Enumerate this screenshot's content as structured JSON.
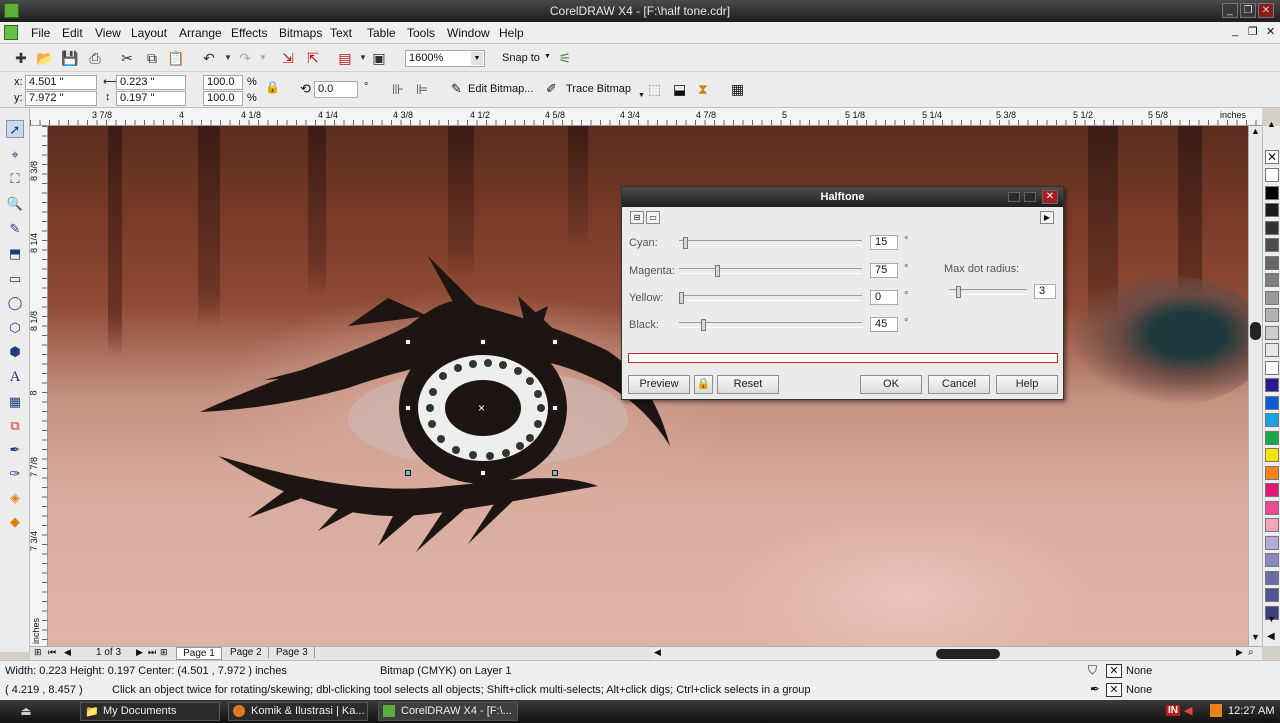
{
  "window": {
    "title": "CorelDRAW X4 - [F:\\half tone.cdr]"
  },
  "menu": [
    "File",
    "Edit",
    "View",
    "Layout",
    "Arrange",
    "Effects",
    "Bitmaps",
    "Text",
    "Table",
    "Tools",
    "Window",
    "Help"
  ],
  "standard_toolbar": {
    "zoom": "1600%",
    "snap_to": "Snap to"
  },
  "property_bar": {
    "x_label": "x:",
    "x": "4.501 \"",
    "y_label": "y:",
    "y": "7.972 \"",
    "width": "0.223 \"",
    "height": "0.197 \"",
    "scale_x": "100.0",
    "scale_y": "100.0",
    "percent": "%",
    "rotation": "0.0",
    "degree": "°",
    "edit_bitmap": "Edit Bitmap...",
    "trace_bitmap": "Trace Bitmap"
  },
  "ruler": {
    "h_labels": [
      "3 7/8",
      "4",
      "4 1/8",
      "4 1/4",
      "4 3/8",
      "4 1/2",
      "4 5/8",
      "4 3/4",
      "4 7/8",
      "5",
      "5 1/8",
      "5 1/4",
      "5 3/8",
      "5 1/2",
      "5 5/8"
    ],
    "h_unit": "inches",
    "v_labels": [
      "8 3/8",
      "8 1/4",
      "8 1/8",
      "8",
      "7 7/8",
      "7 3/4"
    ],
    "v_unit": "inches"
  },
  "dialog": {
    "title": "Halftone",
    "sliders": [
      {
        "label": "Cyan:",
        "value": "15",
        "fraction": 0.02
      },
      {
        "label": "Magenta:",
        "value": "75",
        "fraction": 0.2
      },
      {
        "label": "Yellow:",
        "value": "0",
        "fraction": 0.0
      },
      {
        "label": "Black:",
        "value": "45",
        "fraction": 0.125
      }
    ],
    "degree": "°",
    "max_dot_label": "Max dot radius:",
    "max_dot_value": "3",
    "max_dot_fraction": 0.09,
    "buttons": {
      "preview": "Preview",
      "reset": "Reset",
      "ok": "OK",
      "cancel": "Cancel",
      "help": "Help"
    }
  },
  "page_nav": {
    "counter": "1 of 3",
    "pages": [
      "Page 1",
      "Page 2",
      "Page 3"
    ]
  },
  "status": {
    "dims": "Width: 0.223  Height: 0.197  Center: (4.501 , 7.972 )  inches",
    "object": "Bitmap (CMYK) on Layer 1",
    "cursor": "( 4.219 , 8.457 )",
    "hint": "Click an object twice for rotating/skewing; dbl-clicking tool selects all objects; Shift+click multi-selects; Alt+click digs; Ctrl+click selects in a group",
    "fill": "None",
    "outline": "None"
  },
  "taskbar": {
    "tasks": [
      "My Documents",
      "Komik & Ilustrasi | Ka...",
      "CorelDRAW X4 - [F:\\..."
    ],
    "lang": "IN",
    "clock": "12:27 AM"
  },
  "palette_colors": [
    "#ffffff",
    "#000000",
    "#1c1c1c",
    "#333333",
    "#4d4d4d",
    "#666666",
    "#808080",
    "#999999",
    "#b3b3b3",
    "#cccccc",
    "#e6e6e6",
    "#ffffff",
    "#2e1a8c",
    "#0a5bd8",
    "#18a4e0",
    "#19a84a",
    "#f6e400",
    "#f58220",
    "#e4166f",
    "#ee4796",
    "#f5a2b8",
    "#b3a8d6",
    "#8a8ac0",
    "#6c6ca8",
    "#545494",
    "#3e3e7e"
  ]
}
